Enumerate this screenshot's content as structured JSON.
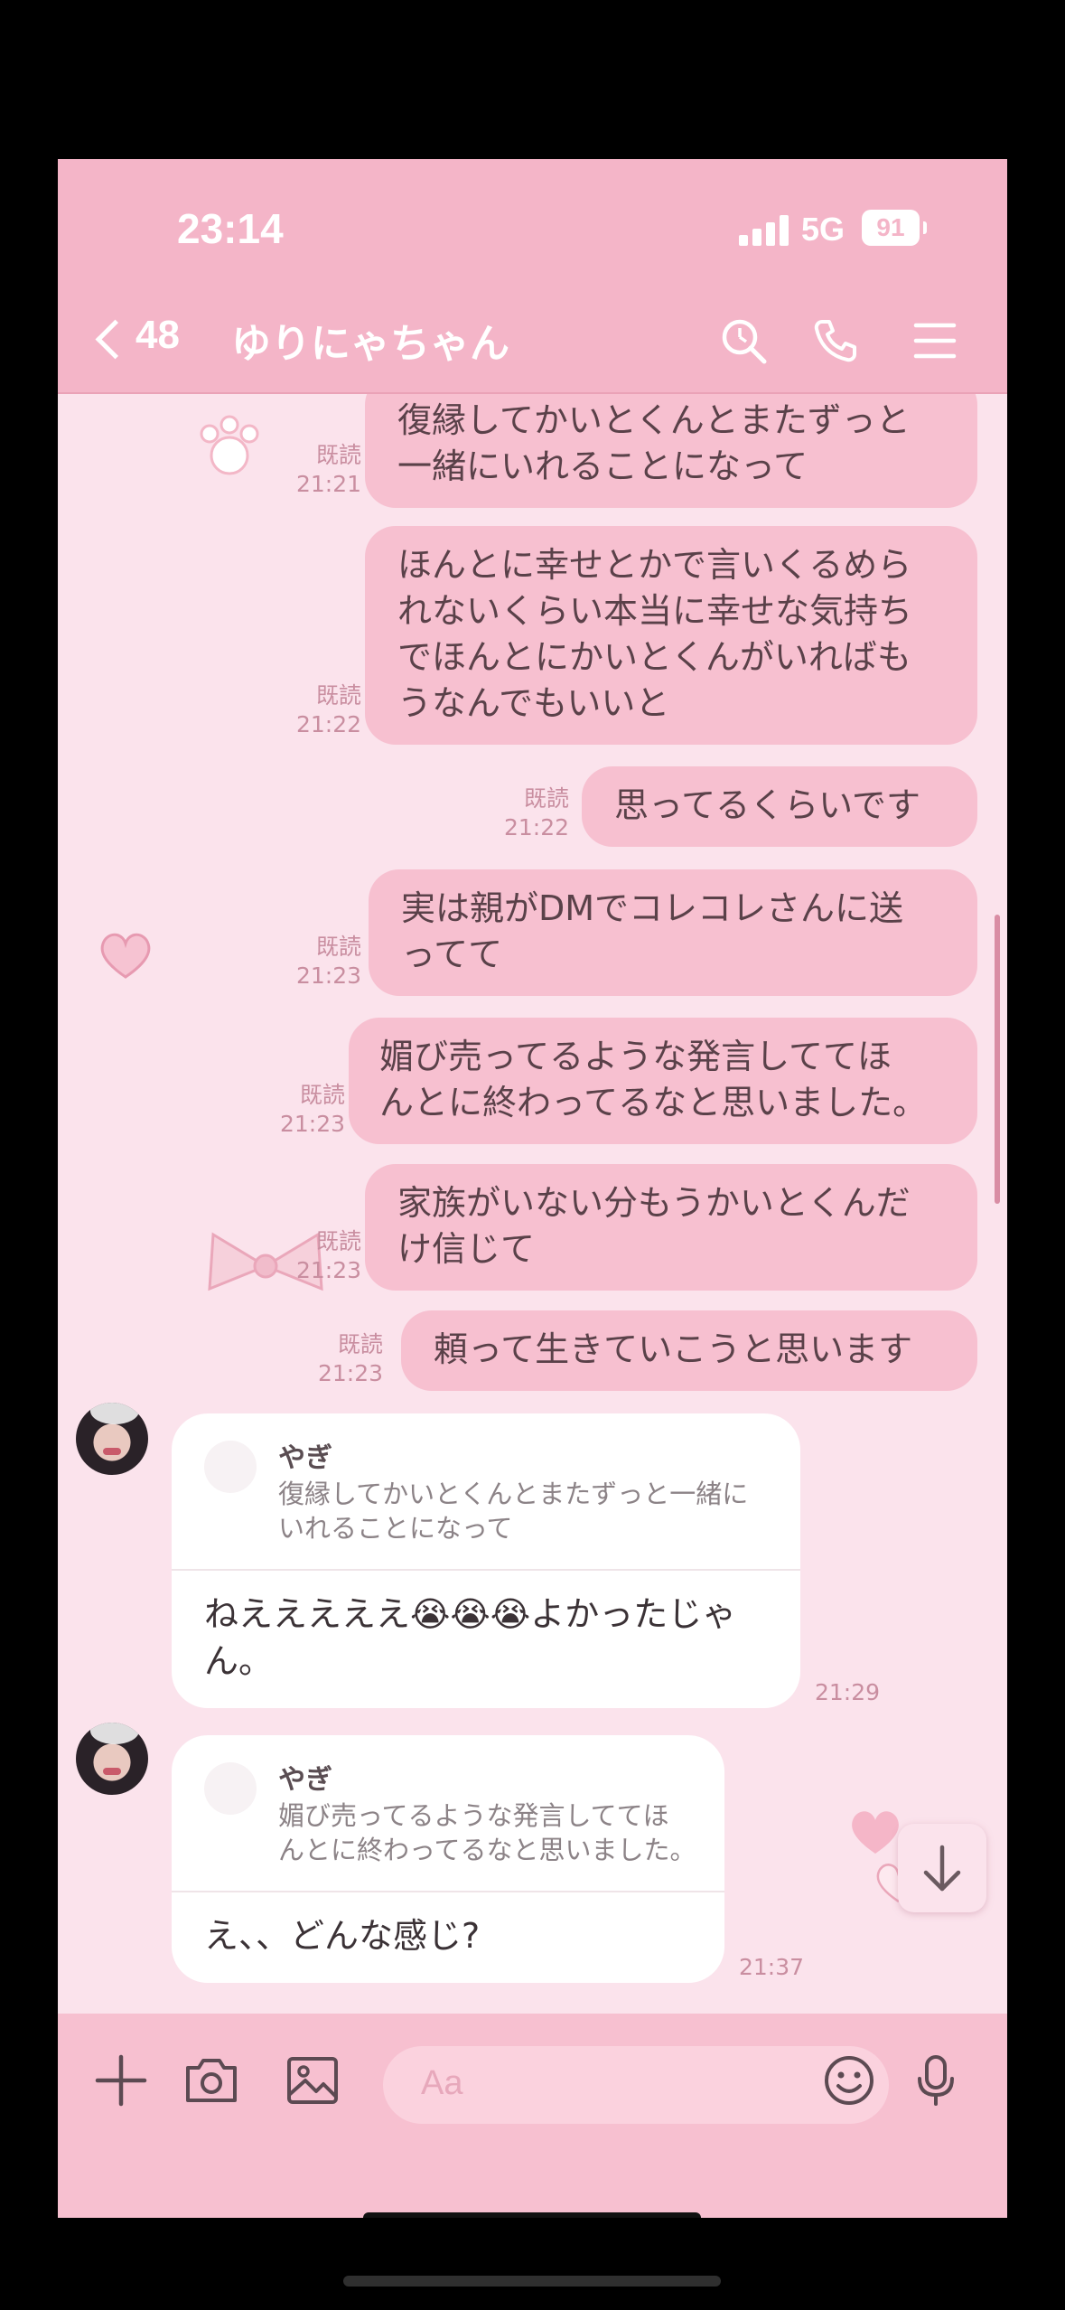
{
  "status": {
    "time": "23:14",
    "network": "5G",
    "battery": "91"
  },
  "header": {
    "unread_count": "48",
    "chat_name": "ゆりにゃちゃん"
  },
  "outgoing": [
    {
      "text": "復縁してかいとくんとまたずっと\n一緒にいれることになって",
      "read": "既読",
      "time": "21:21"
    },
    {
      "text": "ほんとに幸せとかで言いくるめら\nれないくらい本当に幸せな気持ち\nでほんとにかいとくんがいればも\nうなんでもいいと",
      "read": "既読",
      "time": "21:22"
    },
    {
      "text": "思ってるくらいです",
      "read": "既読",
      "time": "21:22"
    },
    {
      "text": "実は親がDMでコレコレさんに送\nってて",
      "read": "既読",
      "time": "21:23"
    },
    {
      "text": "媚び売ってるような発言しててほ\nんとに終わってるなと思いました。",
      "read": "既読",
      "time": "21:23"
    },
    {
      "text": "家族がいない分もうかいとくんだ\nけ信じて",
      "read": "既読",
      "time": "21:23"
    },
    {
      "text": "頼って生きていこうと思います",
      "read": "既読",
      "time": "21:23"
    }
  ],
  "incoming": [
    {
      "reply_name": "やぎ",
      "reply_text": "復縁してかいとくんとまたずっと一緒に\nいれることになって",
      "text": "ねえええええ😭😭😭よかったじゃ\nん。",
      "time": "21:29"
    },
    {
      "reply_name": "やぎ",
      "reply_text": "媚び売ってるような発言しててほ\nんとに終わってるなと思いました。",
      "text": "え、、どんな感じ?",
      "time": "21:37"
    }
  ],
  "input": {
    "placeholder": "Aa"
  },
  "colors": {
    "header": "#f4b5c8",
    "bubble_out": "#f7c0d0",
    "background": "#fbe3ec"
  }
}
